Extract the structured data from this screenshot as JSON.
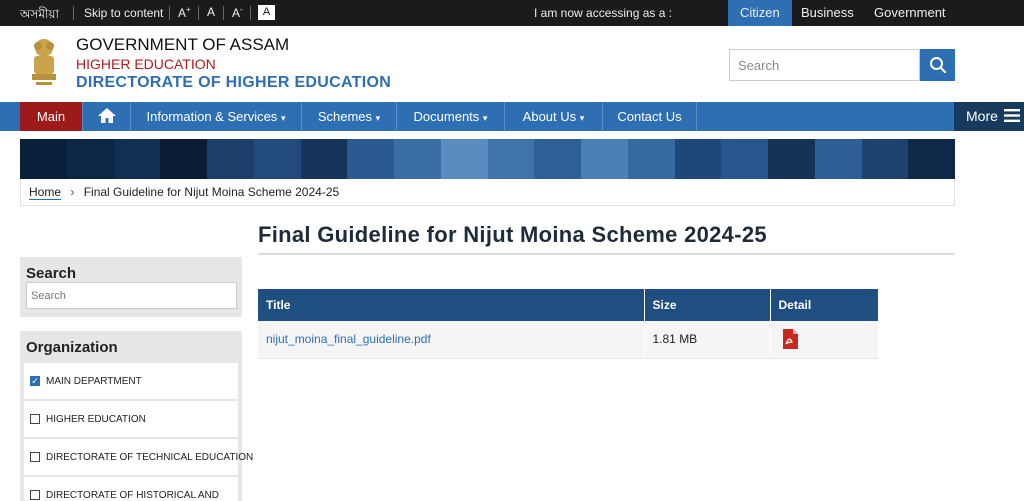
{
  "topbar": {
    "language_link": "অসমীয়া",
    "skip_link": "Skip to content",
    "font_increase": "A+",
    "font_normal": "A",
    "font_decrease": "A-",
    "high_contrast": "A",
    "accessing_label": "I am now accessing as a :",
    "audience_tabs": [
      "Citizen",
      "Business",
      "Government"
    ],
    "active_tab": "Citizen"
  },
  "header": {
    "org_name": "GOVERNMENT OF ASSAM",
    "department": "HIGHER EDUCATION",
    "directorate": "DIRECTORATE OF HIGHER EDUCATION",
    "search_placeholder": "Search"
  },
  "nav": {
    "main": "Main",
    "items": [
      "Information & Services",
      "Schemes",
      "Documents",
      "About Us",
      "Contact Us"
    ],
    "more": "More"
  },
  "breadcrumb": {
    "home": "Home",
    "current": "Final Guideline for Nijut Moina Scheme 2024-25"
  },
  "page": {
    "title": "Final Guideline for Nijut Moina Scheme 2024-25"
  },
  "table": {
    "headers": [
      "Title",
      "Size",
      "Detail"
    ],
    "rows": [
      {
        "title": "nijut_moina_final_guideline.pdf",
        "size": "1.81 MB",
        "detail_icon": "pdf-icon"
      }
    ]
  },
  "sidebar": {
    "search_heading": "Search",
    "search_placeholder": "Search",
    "org_heading": "Organization",
    "org_items": [
      {
        "label": "MAIN DEPARTMENT",
        "checked": true
      },
      {
        "label": "HIGHER EDUCATION",
        "checked": false
      },
      {
        "label": "DIRECTORATE OF TECHNICAL EDUCATION",
        "checked": false
      },
      {
        "label": "DIRECTORATE OF HISTORICAL AND",
        "checked": false
      }
    ]
  },
  "colors": {
    "primary_blue": "#2d6fb2",
    "main_tab_red": "#9d1a1a",
    "table_header": "#1f4e80",
    "topbar": "#1b1b1b"
  }
}
